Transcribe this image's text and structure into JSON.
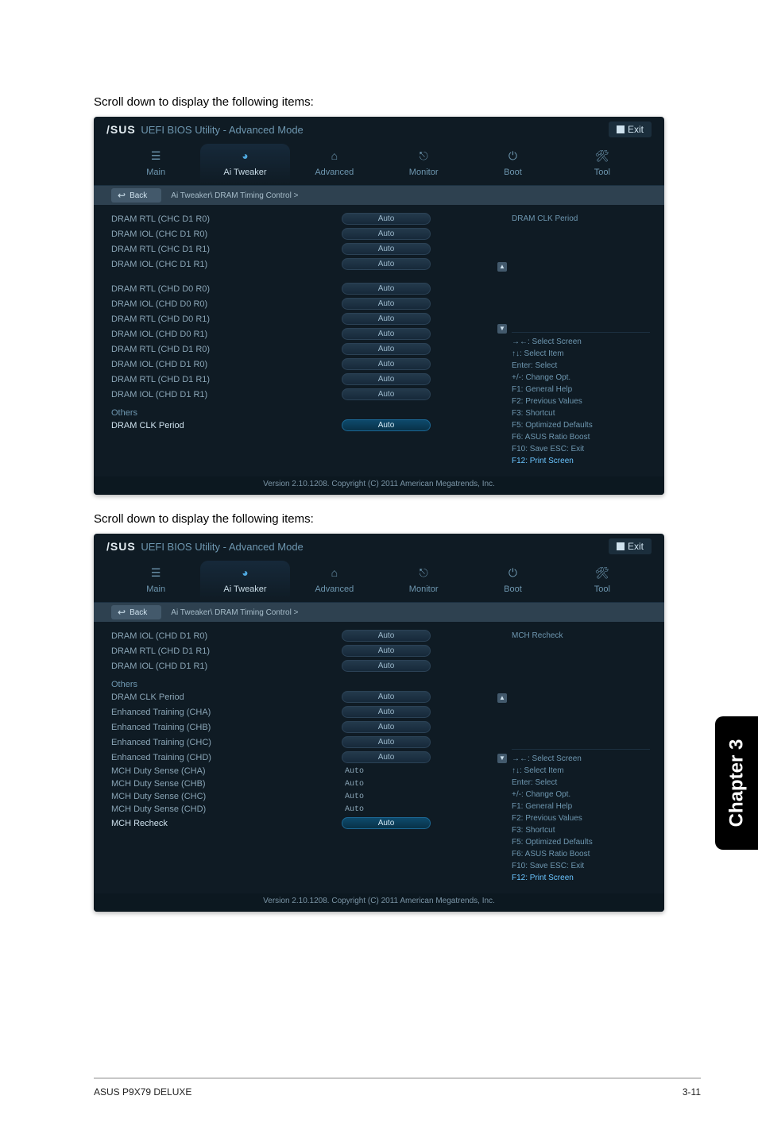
{
  "captions": {
    "cap1": "Scroll down to display the following items:",
    "cap2": "Scroll down to display the following items:"
  },
  "titlebar": {
    "brand": "/SUS",
    "subtitle": "UEFI BIOS Utility - Advanced Mode",
    "exit": "Exit"
  },
  "tabs": {
    "main": "Main",
    "ai": "Ai Tweaker",
    "adv": "Advanced",
    "mon": "Monitor",
    "boot": "Boot",
    "tool": "Tool"
  },
  "breadcrumb": {
    "back": "Back",
    "path": "Ai Tweaker\\ DRAM Timing Control >"
  },
  "screen1": {
    "right_desc": "DRAM CLK Period",
    "rows": [
      {
        "lbl": "DRAM RTL (CHC D1 R0)",
        "val": "Auto",
        "type": "pill"
      },
      {
        "lbl": "DRAM IOL (CHC D1 R0)",
        "val": "Auto",
        "type": "pill"
      },
      {
        "lbl": "DRAM RTL (CHC D1 R1)",
        "val": "Auto",
        "type": "pill"
      },
      {
        "lbl": "DRAM IOL (CHC D1 R1)",
        "val": "Auto",
        "type": "pill"
      },
      {
        "lbl": "DRAM RTL (CHD D0 R0)",
        "val": "Auto",
        "type": "pill",
        "gap": true
      },
      {
        "lbl": "DRAM IOL (CHD D0 R0)",
        "val": "Auto",
        "type": "pill"
      },
      {
        "lbl": "DRAM RTL (CHD D0 R1)",
        "val": "Auto",
        "type": "pill"
      },
      {
        "lbl": "DRAM IOL (CHD D0 R1)",
        "val": "Auto",
        "type": "pill"
      },
      {
        "lbl": "DRAM RTL (CHD D1 R0)",
        "val": "Auto",
        "type": "pill"
      },
      {
        "lbl": "DRAM IOL (CHD D1 R0)",
        "val": "Auto",
        "type": "pill"
      },
      {
        "lbl": "DRAM RTL (CHD D1 R1)",
        "val": "Auto",
        "type": "pill"
      },
      {
        "lbl": "DRAM IOL (CHD D1 R1)",
        "val": "Auto",
        "type": "pill"
      }
    ],
    "others_head": "Others",
    "selected": {
      "lbl": "DRAM CLK Period",
      "val": "Auto"
    }
  },
  "screen2": {
    "right_desc": "MCH Recheck",
    "rows": [
      {
        "lbl": "DRAM IOL (CHD D1 R0)",
        "val": "Auto",
        "type": "pill"
      },
      {
        "lbl": "DRAM RTL (CHD D1 R1)",
        "val": "Auto",
        "type": "pill"
      },
      {
        "lbl": "DRAM IOL (CHD D1 R1)",
        "val": "Auto",
        "type": "pill"
      }
    ],
    "others_head": "Others",
    "rows2": [
      {
        "lbl": "DRAM CLK Period",
        "val": "Auto",
        "type": "pill"
      },
      {
        "lbl": "Enhanced Training (CHA)",
        "val": "Auto",
        "type": "pill"
      },
      {
        "lbl": "Enhanced Training (CHB)",
        "val": "Auto",
        "type": "pill"
      },
      {
        "lbl": "Enhanced Training (CHC)",
        "val": "Auto",
        "type": "pill"
      },
      {
        "lbl": "Enhanced Training (CHD)",
        "val": "Auto",
        "type": "pill"
      },
      {
        "lbl": "MCH Duty Sense (CHA)",
        "val": "Auto",
        "type": "text"
      },
      {
        "lbl": "MCH Duty Sense (CHB)",
        "val": "Auto",
        "type": "text"
      },
      {
        "lbl": "MCH Duty Sense (CHC)",
        "val": "Auto",
        "type": "text"
      },
      {
        "lbl": "MCH Duty Sense (CHD)",
        "val": "Auto",
        "type": "text"
      }
    ],
    "selected": {
      "lbl": "MCH Recheck",
      "val": "Auto"
    }
  },
  "help": {
    "k1": "→←: Select Screen",
    "k2": "↑↓: Select Item",
    "k3": "Enter: Select",
    "k4": "+/-: Change Opt.",
    "k5": "F1: General Help",
    "k6": "F2: Previous Values",
    "k7": "F3: Shortcut",
    "k8": "F5: Optimized Defaults",
    "k9": "F6: ASUS Ratio Boost",
    "k10": "F10: Save  ESC: Exit",
    "k11": "F12: Print Screen"
  },
  "version": "Version 2.10.1208. Copyright (C) 2011 American Megatrends, Inc.",
  "chapter": "Chapter 3",
  "footer": {
    "left": "ASUS P9X79 DELUXE",
    "right": "3-11"
  }
}
